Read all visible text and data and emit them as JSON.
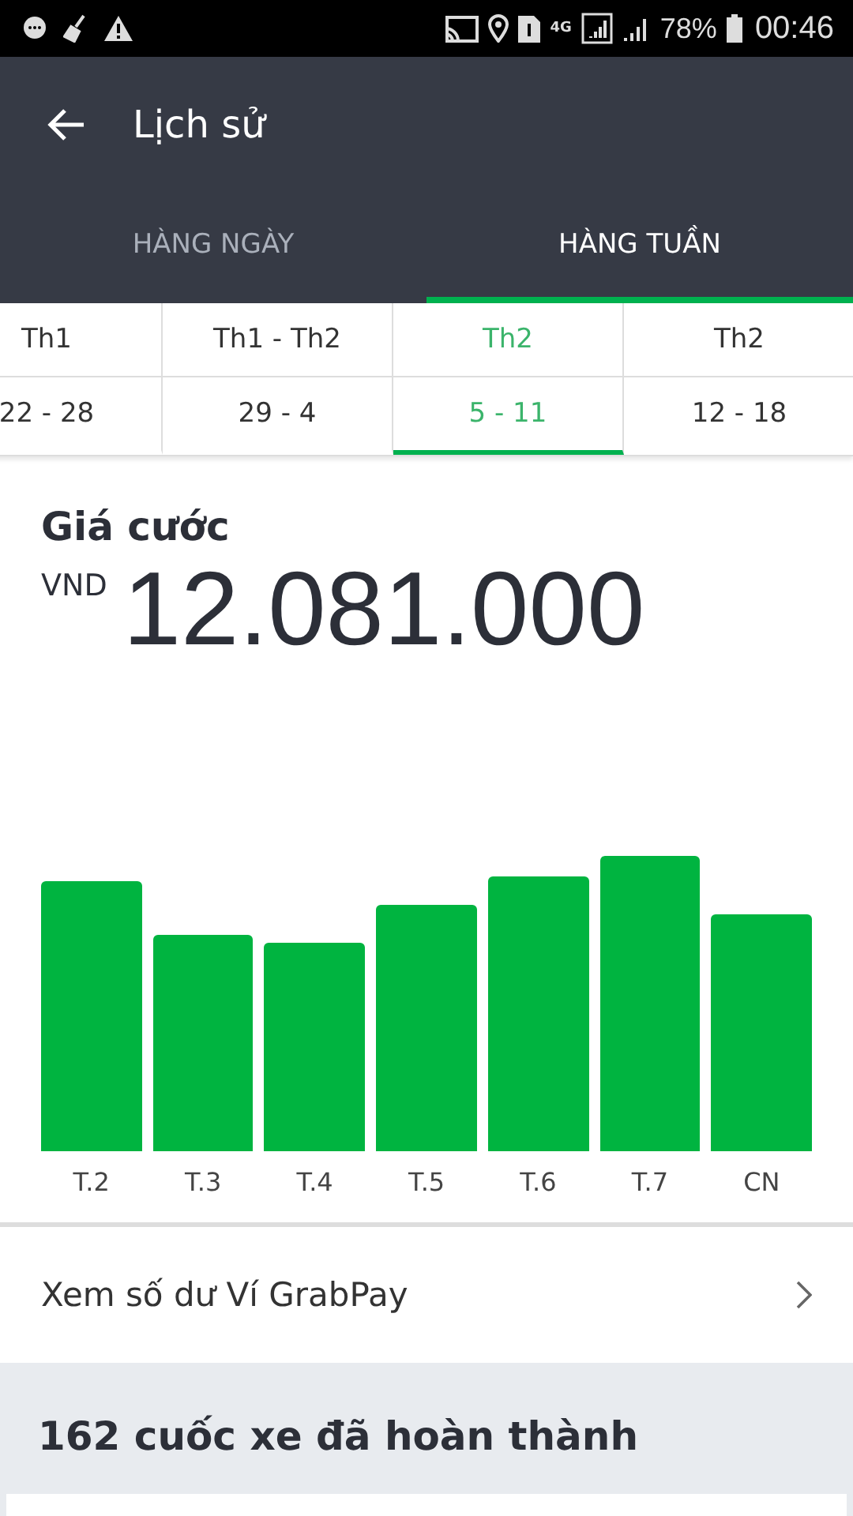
{
  "status_bar": {
    "battery": "78%",
    "time": "00:46",
    "network": "4G"
  },
  "header": {
    "title": "Lịch sử"
  },
  "tabs": [
    {
      "label": "HÀNG NGÀY",
      "selected": false
    },
    {
      "label": "HÀNG TUẦN",
      "selected": true
    }
  ],
  "weeks": [
    {
      "month": "Th1",
      "days": "22 - 28",
      "selected": false
    },
    {
      "month": "Th1 - Th2",
      "days": "29 - 4",
      "selected": false
    },
    {
      "month": "Th2",
      "days": "5 - 11",
      "selected": true
    },
    {
      "month": "Th2",
      "days": "12 - 18",
      "selected": false
    }
  ],
  "fare": {
    "label": "Giá cước",
    "currency": "VND",
    "amount": "12.081.000"
  },
  "chart_labels": [
    "T.2",
    "T.3",
    "T.4",
    "T.5",
    "T.6",
    "T.7",
    "CN"
  ],
  "wallet_link": {
    "label": "Xem số dư Ví GrabPay"
  },
  "trips": {
    "title": "162 cuốc xe đã hoàn thành"
  }
}
